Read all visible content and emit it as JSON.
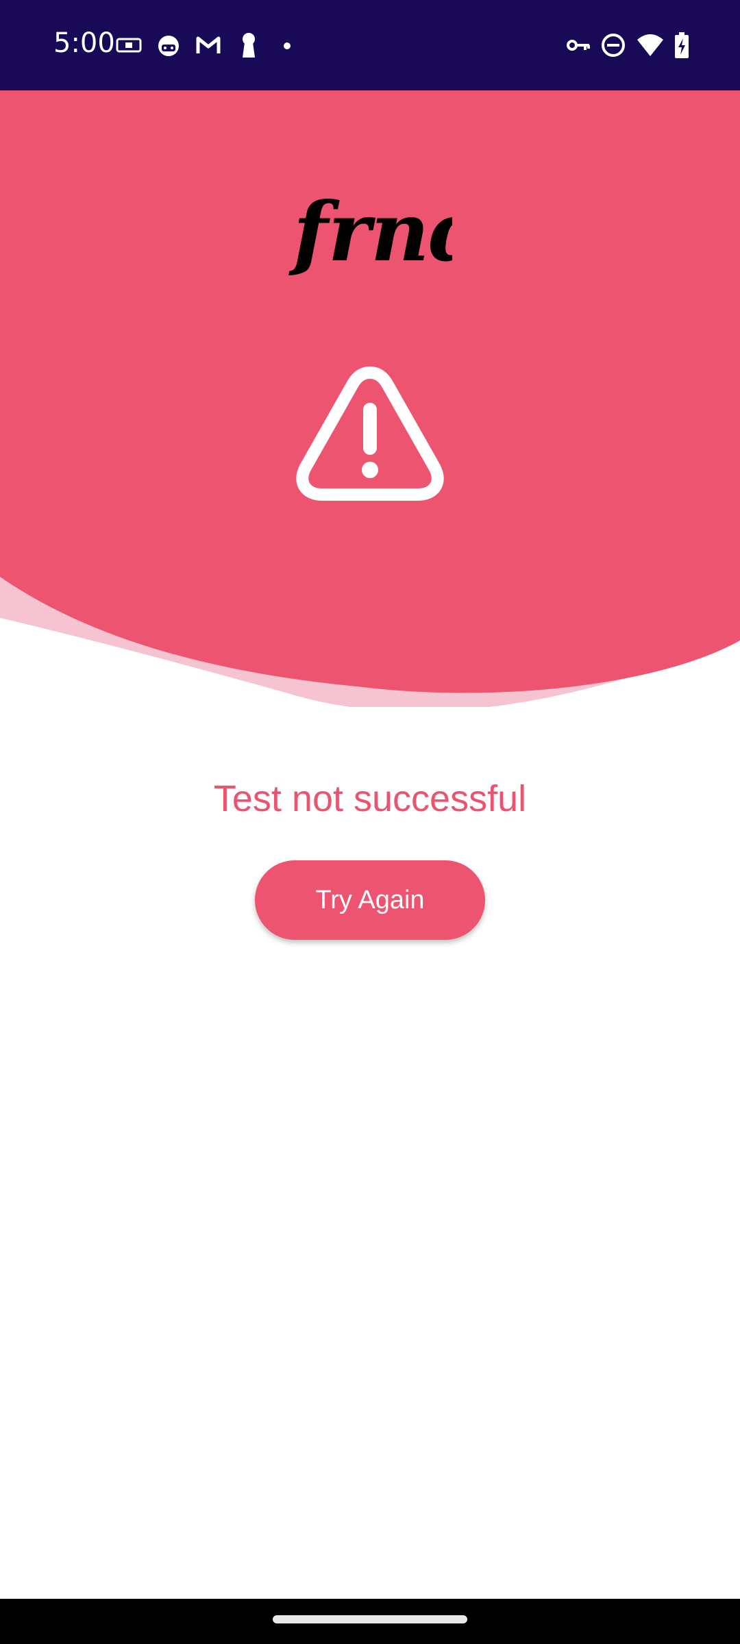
{
  "status_bar": {
    "time": "5:00",
    "left_icons": [
      "card-icon",
      "face-icon",
      "gmail-icon",
      "keyhole-icon",
      "dot-icon"
    ],
    "right_icons": [
      "key-icon",
      "do-not-disturb-icon",
      "wifi-icon",
      "battery-charging-icon"
    ]
  },
  "app": {
    "logo_text": "frnd",
    "alert_icon": "warning-triangle-icon"
  },
  "main": {
    "message": "Test not successful",
    "try_again_label": "Try Again"
  },
  "colors": {
    "status_bar": "#180a56",
    "primary": "#ec5470",
    "primary_light": "#f6c3d0",
    "text_accent": "#e9546f",
    "background": "#ffffff"
  }
}
